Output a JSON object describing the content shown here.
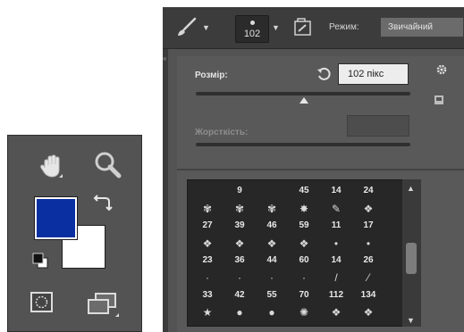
{
  "tools_panel": {
    "icons": {
      "hand": "hand-tool-icon",
      "zoom": "zoom-tool-icon",
      "swap": "swap-colors-icon",
      "default": "default-colors-icon",
      "quick_mask": "quick-mask-icon",
      "screen_mode": "screen-mode-icon"
    },
    "foreground_color": "#0a2fa0",
    "background_color": "#ffffff"
  },
  "options_bar": {
    "brush_size_value": "102",
    "mode_label": "Режим:",
    "mode_value": "Звичайний"
  },
  "brush_panel": {
    "size_label": "Розмір:",
    "size_value": "102 пікс",
    "hardness_label": "Жорсткість:",
    "size_slider_percent": 50,
    "presets": {
      "row0": [
        "",
        "9",
        "",
        "45",
        "14",
        "24"
      ],
      "row1_glyphs": [
        "✾",
        "✾",
        "✾",
        "✸",
        "✎",
        "❖"
      ],
      "row2": [
        "27",
        "39",
        "46",
        "59",
        "11",
        "17"
      ],
      "row3_glyphs": [
        "❖",
        "❖",
        "❖",
        "❖",
        "•",
        "•"
      ],
      "row4": [
        "23",
        "36",
        "44",
        "60",
        "14",
        "26"
      ],
      "row5_glyphs": [
        "·",
        "·",
        "·",
        "·",
        "/",
        "⁄"
      ],
      "row6": [
        "33",
        "42",
        "55",
        "70",
        "112",
        "134"
      ],
      "row7_glyphs": [
        "★",
        "●",
        "●",
        "✺",
        "❖",
        "❖"
      ]
    }
  }
}
